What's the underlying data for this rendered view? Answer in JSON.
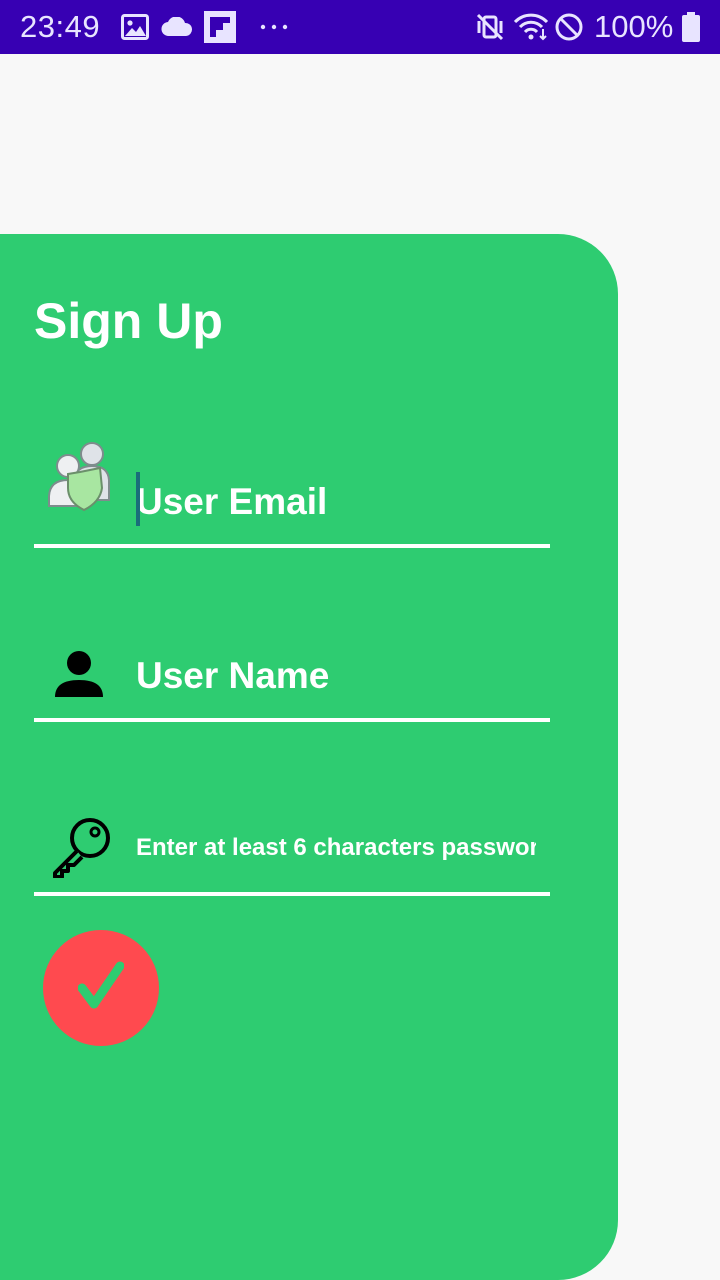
{
  "status_bar": {
    "time": "23:49",
    "battery_text": "100%",
    "left_icons": [
      "gallery-icon",
      "cloud-icon",
      "flipboard-icon",
      "more-dots-icon"
    ],
    "right_icons": [
      "mute-vibrate-icon",
      "wifi-icon",
      "do-not-disturb-icon",
      "battery-icon"
    ],
    "background_color": "#3700b3"
  },
  "signup": {
    "title": "Sign Up",
    "card_color": "#2ecc71",
    "email": {
      "placeholder": "User Email",
      "value": "",
      "icon": "user-shield-icon"
    },
    "name": {
      "placeholder": "User Name",
      "value": "",
      "icon": "person-icon"
    },
    "password": {
      "placeholder": "Enter at least 6 characters passwor",
      "value": "",
      "icon": "key-icon"
    },
    "submit": {
      "icon": "checkmark-icon",
      "color": "#ff4a4f"
    }
  }
}
